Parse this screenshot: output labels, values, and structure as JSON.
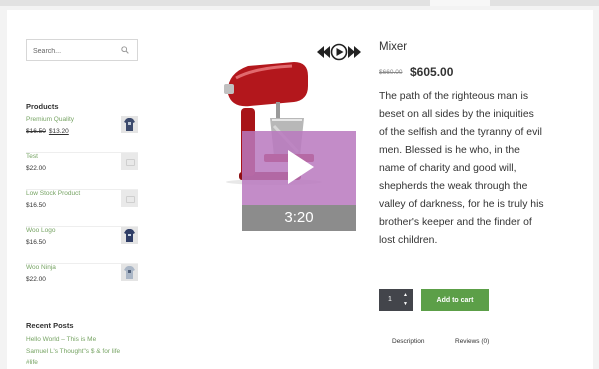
{
  "search": {
    "placeholder": "Search..."
  },
  "sidebar": {
    "products_heading": "Products",
    "products": [
      {
        "name": "Premium Quality",
        "old_price": "$16.50",
        "price": "$13.20",
        "thumb": "tshirt-icon"
      },
      {
        "name": "Test",
        "price": "$22.00",
        "thumb": "placeholder-image-icon"
      },
      {
        "name": "Low Stock Product",
        "price": "$16.50",
        "thumb": "placeholder-image-icon"
      },
      {
        "name": "Woo Logo",
        "price": "$16.50",
        "thumb": "tshirt-icon"
      },
      {
        "name": "Woo Ninja",
        "price": "$22.00",
        "thumb": "tshirt-icon"
      }
    ],
    "recent_posts_heading": "Recent Posts",
    "recent_posts": [
      "Hello World – This is Me",
      "Samuel L's Thought\"s $ & for life",
      "#life"
    ]
  },
  "product": {
    "title": "Mixer",
    "old_price": "$660.00",
    "price": "$605.00",
    "description": "The path of the righteous man is beset on all sides by the iniquities of the selfish and the tyranny of evil men. Blessed is he who, in the name of charity and good will, shepherds the weak through the valley of darkness, for he is truly his brother's keeper and the finder of lost children.",
    "quantity": "1",
    "add_to_cart_label": "Add to cart",
    "tabs": [
      "Description",
      "Reviews (0)"
    ]
  },
  "video": {
    "duration": "3:20"
  },
  "colors": {
    "link_green": "#77a464",
    "button_green": "#5c9f48",
    "video_overlay": "#b878be",
    "qty_bg": "#43454b"
  }
}
